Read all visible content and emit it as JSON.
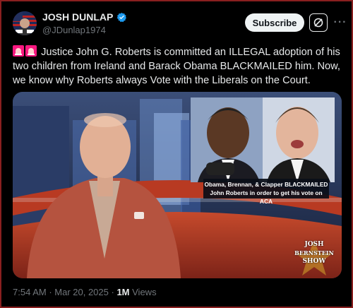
{
  "author": {
    "display_name": "JOSH DUNLAP",
    "handle": "@JDunlap1974",
    "avatar_icon": "avatar-icon",
    "verified_icon": "verified-badge-icon"
  },
  "header": {
    "subscribe_label": "Subscribe",
    "grok_icon": "grok-icon",
    "more_icon": "more-icon",
    "more_glyph": "···"
  },
  "tweet": {
    "lead_icons": [
      "siren-icon",
      "siren-icon"
    ],
    "text": "Justice John G. Roberts is committed an ILLEGAL adoption of his two children from Ireland and Barack Obama BLACKMAILED him. Now, we know why Roberts always Vote with the Liberals on the Court."
  },
  "media": {
    "caption_line1": "Obama, Brennan, & Clapper BLACKMAILED",
    "caption_line2": "John Roberts in order to get his vote on ACA",
    "logo_line1": "JOSH",
    "logo_line2": "BERNSTEIN",
    "logo_line3": "SHOW"
  },
  "footer": {
    "time": "7:54 AM",
    "separator": " · ",
    "date": "Mar 20, 2025",
    "views_count": "1M",
    "views_label": "Views"
  },
  "colors": {
    "background": "#000000",
    "text": "#e7e9ea",
    "muted": "#71767b",
    "verified": "#1d9bf0",
    "border": "#8a1f1f",
    "siren": "#f91880"
  }
}
